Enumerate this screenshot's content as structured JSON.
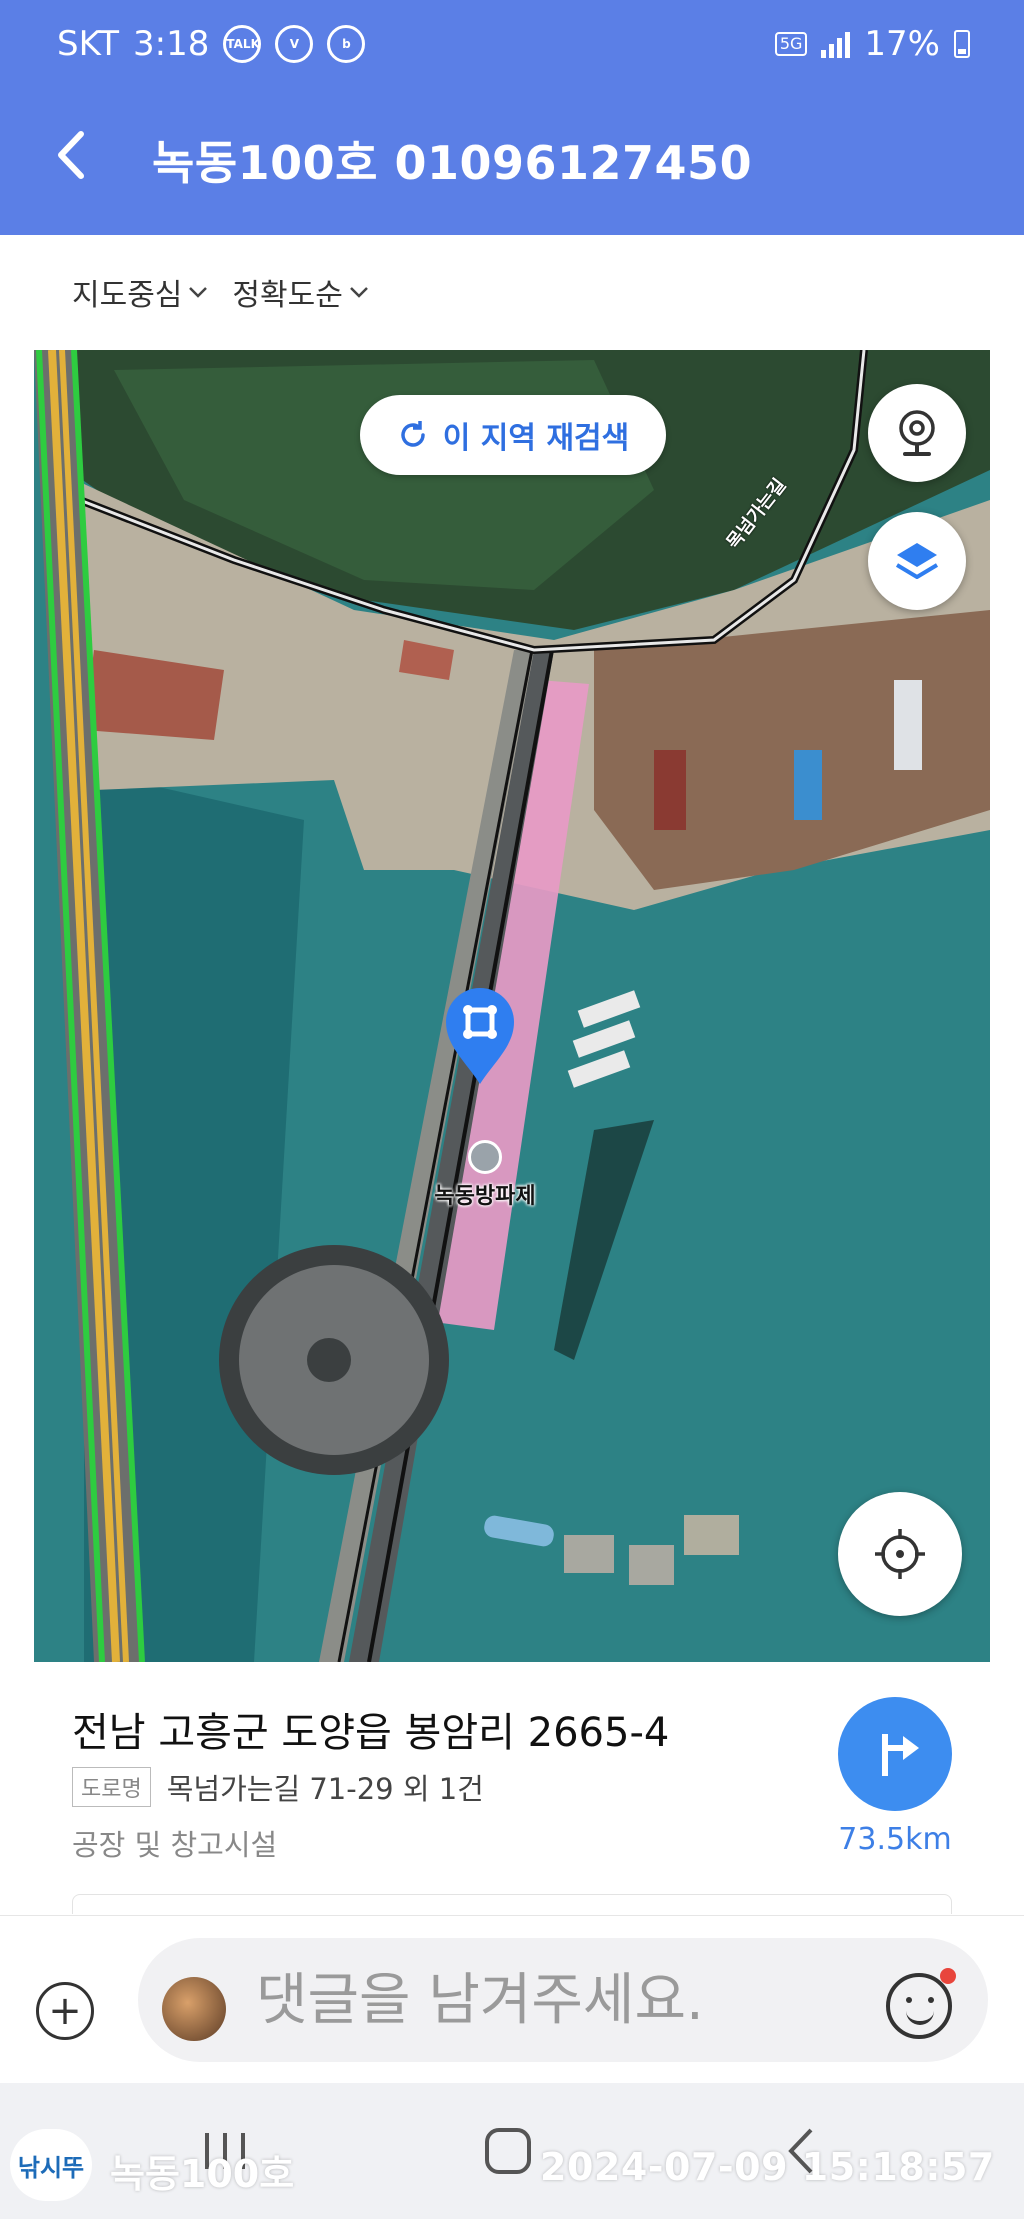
{
  "status_bar": {
    "carrier": "SKT",
    "time": "3:18",
    "network": "5G",
    "battery": "17%",
    "icons": [
      "kakaotalk-icon",
      "volte-icon",
      "band-icon",
      "signal-icon",
      "battery-charging-icon"
    ]
  },
  "header": {
    "title": "녹동100호 01096127450",
    "back_icon": "chevron-left-icon"
  },
  "filters": [
    {
      "label": "지도중심"
    },
    {
      "label": "정확도순"
    }
  ],
  "map": {
    "research_label": "이 지역 재검색",
    "poi_label": "녹동방파제",
    "road_label": "목넘가는길",
    "buttons": [
      "cctv-icon",
      "layers-icon",
      "my-location-icon"
    ],
    "colors": {
      "accent": "#5b7fe6",
      "marker": "#2f7ef0",
      "highlight": "#e89ac7"
    }
  },
  "place": {
    "address": "전남 고흥군 도양읍 봉암리 2665-4",
    "road_tag": "도로명",
    "road_address": "목넘가는길 71-29 외 1건",
    "category": "공장 및 창고시설",
    "distance": "73.5km"
  },
  "comment": {
    "placeholder": "댓글을 남겨주세요."
  },
  "watermark": {
    "logo": "낚시뚜",
    "name": "녹동100호",
    "timestamp": "2024-07-09 15:18:57"
  }
}
